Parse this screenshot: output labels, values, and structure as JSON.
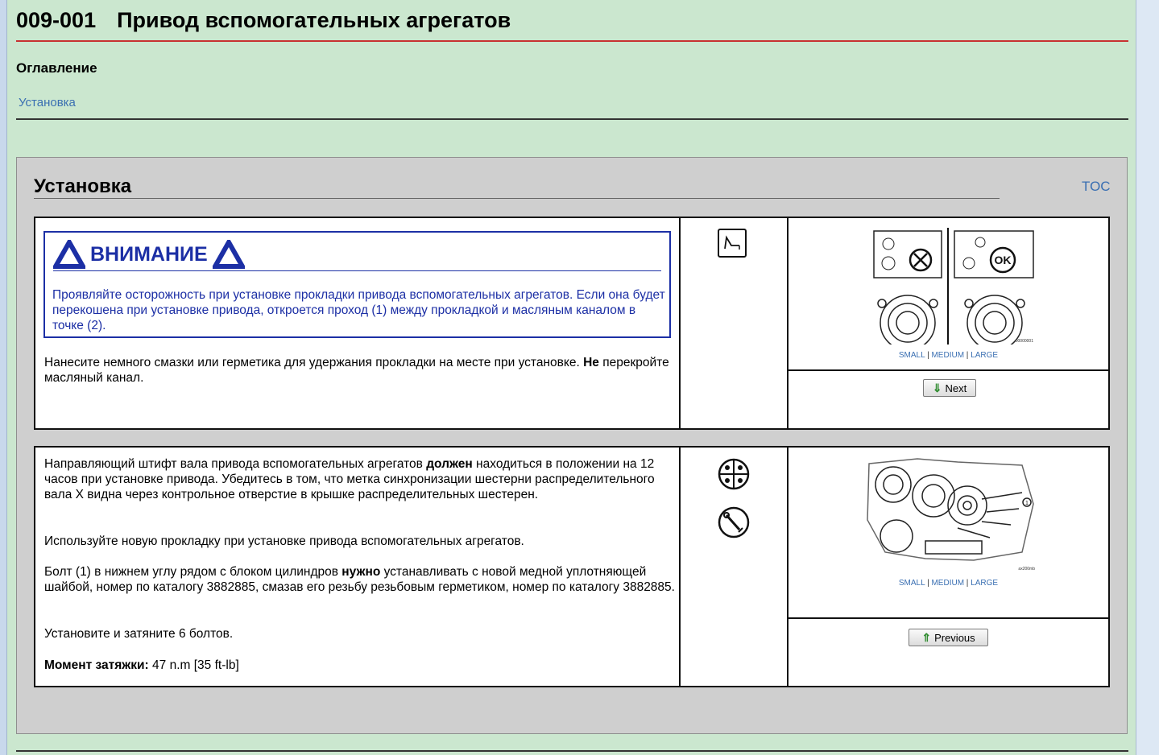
{
  "doc": {
    "number": "009-001",
    "title": "Привод вспомогательных агрегатов"
  },
  "toc": {
    "heading": "Оглавление",
    "items": [
      "Установка"
    ]
  },
  "section": {
    "title": "Установка",
    "toc_link": "TOC",
    "step1": {
      "warning_label": "ВНИМАНИЕ",
      "warning_text": "Проявляйте осторожность при установке прокладки привода вспомогательных агрегатов. Если она будет перекошена при установке привода, откроется проход (1) между прокладкой и масляным каналом в точке (2).",
      "text_pre": "Нанесите немного смазки или герметика для удержания прокладки на месте при установке. ",
      "text_bold": "Не",
      "text_post": " перекройте масляный канал.",
      "figure_id": "00000001",
      "sizes": [
        "SMALL",
        "MEDIUM",
        "LARGE"
      ],
      "nav_button": "Next"
    },
    "step2": {
      "p1_pre": "Направляющий штифт вала привода вспомогательных агрегатов ",
      "p1_bold": "должен",
      "p1_post": " находиться в положении на 12 часов при установке привода. Убедитесь в том, что метка синхронизации шестерни распределительного вала X видна через контрольное отверстие в крышке распределительных шестерен.",
      "p2": "Используйте новую прокладку при установке привода вспомогательных агрегатов.",
      "p3_pre": "Болт (1) в нижнем углу рядом с блоком цилиндров ",
      "p3_bold": "нужно",
      "p3_post": " устанавливать с новой медной уплотняющей шайбой, номер по каталогу 3882885, смазав его резьбу резьбовым герметиком, номер по каталогу 3882885.",
      "p4": "Установите и затяните 6 болтов.",
      "torque_label": "Момент затяжки:",
      "torque_value": "47",
      "torque_unit": "n.m",
      "torque_alt": "[35 ft-lb]",
      "figure_id": "ax200mb",
      "sizes": [
        "SMALL",
        "MEDIUM",
        "LARGE"
      ],
      "nav_button": "Previous"
    }
  },
  "colors": {
    "page_bg": "#cbe7cf",
    "section_bg": "#cfcfcf",
    "link": "#3a6fb2",
    "warning": "#1c2fa5",
    "title_rule": "#c83232"
  }
}
